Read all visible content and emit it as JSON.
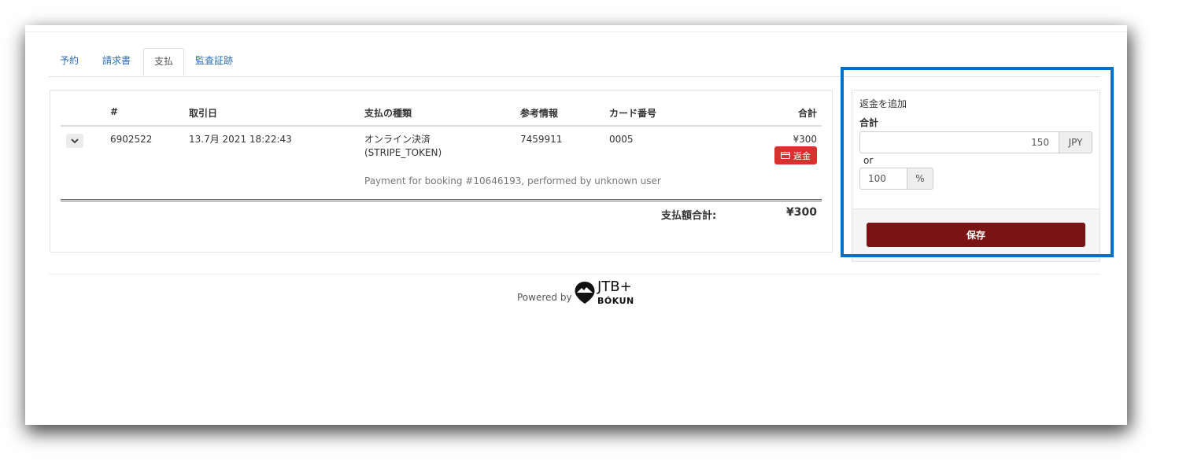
{
  "tabs": [
    {
      "label": "予約"
    },
    {
      "label": "請求書"
    },
    {
      "label": "支払"
    },
    {
      "label": "監査証跡"
    }
  ],
  "active_tab": "支払",
  "payments": {
    "columns": [
      "#",
      "取引日",
      "支払の種類",
      "参考情報",
      "カード番号",
      "合計"
    ],
    "rows": [
      {
        "id": "6902522",
        "date": "13.7月 2021 18:22:43",
        "type_line1": "オンライン決済",
        "type_line2": "(STRIPE_TOKEN)",
        "reference": "7459911",
        "card": "0005",
        "total": "¥300",
        "refund_label": "返金",
        "description": "Payment for booking #10646193, performed by unknown user"
      }
    ],
    "sum_label": "支払額合計:",
    "sum_value": "¥300"
  },
  "refund_form": {
    "title": "返金を追加",
    "amount_label": "合計",
    "amount_value": "150",
    "currency": "JPY",
    "or_text": "or",
    "percent_value": "100",
    "percent_symbol": "%",
    "save_label": "保存"
  },
  "footer": {
    "powered_by": "Powered by",
    "logo_top": "JTB+",
    "logo_bottom": "BÓKUN"
  },
  "colors": {
    "link": "#2f6db5",
    "refund_button": "#d7322e",
    "save_button": "#7a1414",
    "highlight": "#0a6fc2"
  }
}
